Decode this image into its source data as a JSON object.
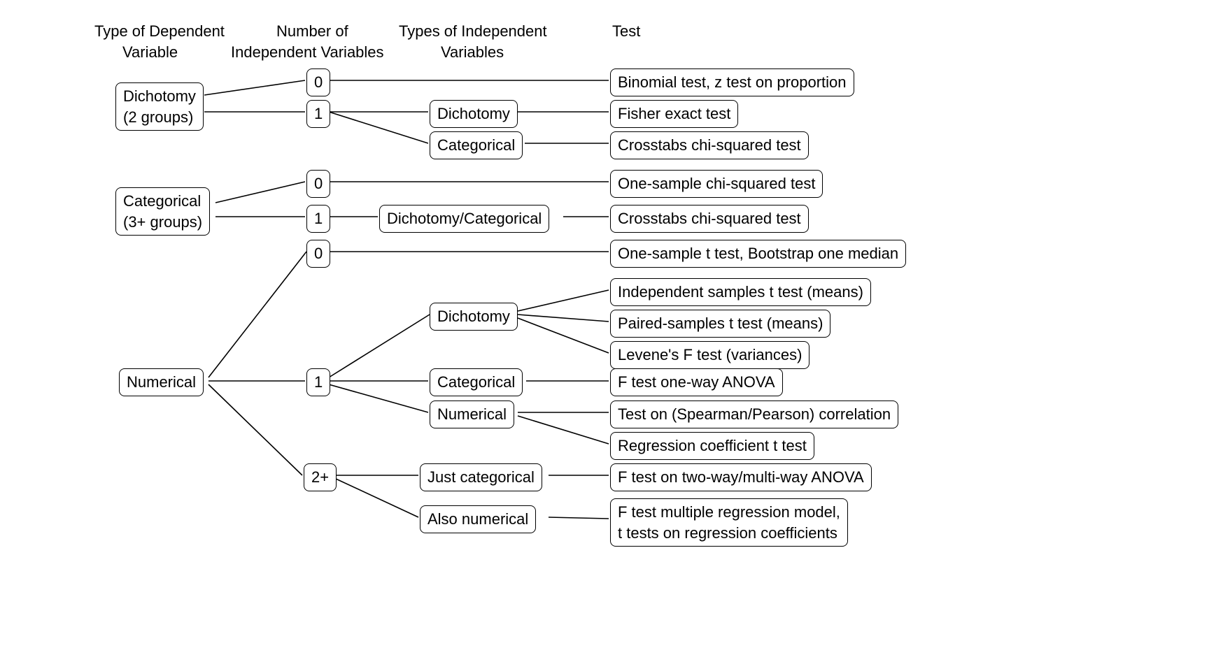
{
  "headers": {
    "col1_line1": "Type of Dependent",
    "col1_line2": "Variable",
    "col2_line1": "Number of",
    "col2_line2": "Independent Variables",
    "col3_line1": "Types of Independent",
    "col3_line2": "Variables",
    "col4_line1": "Test"
  },
  "nodes": {
    "dv_dich_l1": "Dichotomy",
    "dv_dich_l2": "(2 groups)",
    "dv_cat_l1": "Categorical",
    "dv_cat_l2": "(3+ groups)",
    "dv_num": "Numerical",
    "n0a": "0",
    "n1a": "1",
    "n0b": "0",
    "n1b": "1",
    "n0c": "0",
    "n1c": "1",
    "n2p": "2+",
    "iv_dich1": "Dichotomy",
    "iv_cat1": "Categorical",
    "iv_dichcat": "Dichotomy/Categorical",
    "iv_dich2": "Dichotomy",
    "iv_cat2": "Categorical",
    "iv_num": "Numerical",
    "iv_justcat": "Just categorical",
    "iv_alsonum": "Also numerical",
    "t_binom": "Binomial test, z test on proportion",
    "t_fisher": "Fisher exact test",
    "t_xtab1": "Crosstabs chi-squared test",
    "t_1schi": "One-sample chi-squared test",
    "t_xtab2": "Crosstabs chi-squared test",
    "t_1st": "One-sample t test, Bootstrap one median",
    "t_indt": "Independent samples t test (means)",
    "t_pair": "Paired-samples t test (means)",
    "t_lev": "Levene's F test (variances)",
    "t_anova1": "F test one-way ANOVA",
    "t_corr": "Test on (Spearman/Pearson) correlation",
    "t_regc": "Regression coefficient t test",
    "t_anova2": "F test on two-way/multi-way ANOVA",
    "t_mreg_l1": "F test multiple regression model,",
    "t_mreg_l2": "t tests on regression coefficients"
  }
}
